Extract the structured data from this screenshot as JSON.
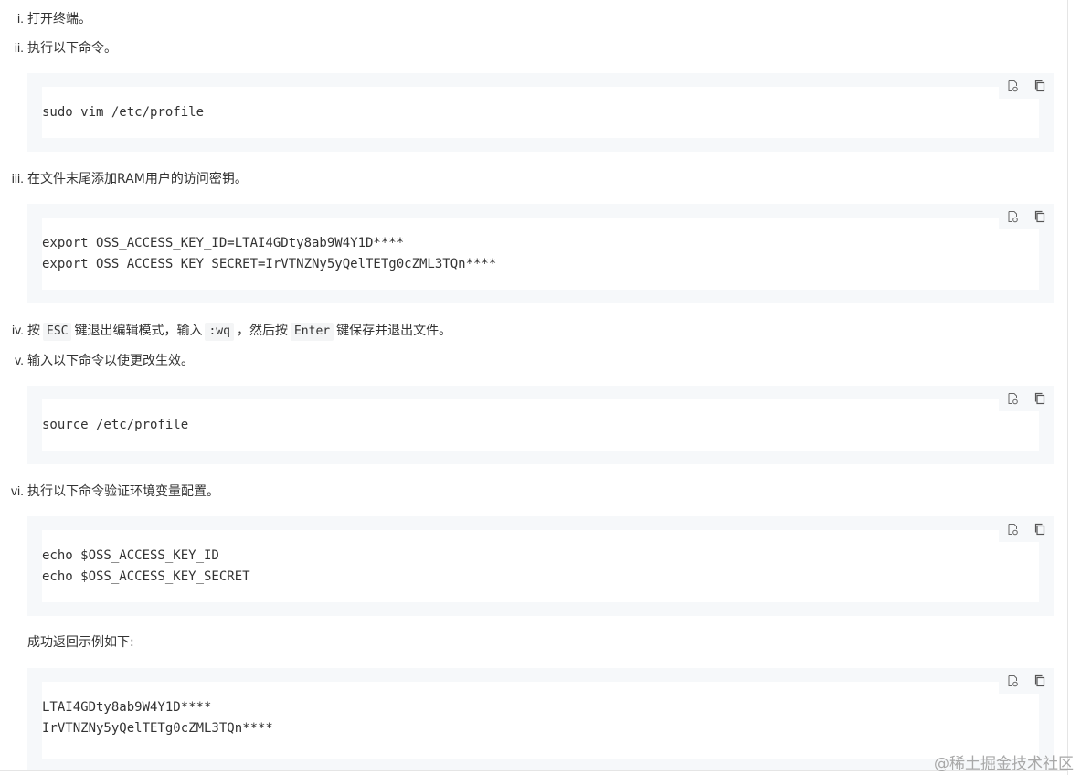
{
  "steps": [
    {
      "num": "i.",
      "text": "打开终端。"
    },
    {
      "num": "ii.",
      "text": "执行以下命令。"
    },
    {
      "num": "iii.",
      "text": "在文件末尾添加RAM用户的访问密钥。"
    },
    {
      "num": "iv.",
      "text_before": "按",
      "code1": "ESC",
      "text_mid1": "键退出编辑模式，输入",
      "code2": ":wq",
      "text_mid2": "，然后按",
      "code3": "Enter",
      "text_after": "键保存并退出文件。"
    },
    {
      "num": "v.",
      "text": "输入以下命令以使更改生效。"
    },
    {
      "num": "vi.",
      "text": "执行以下命令验证环境变量配置。"
    }
  ],
  "result_intro": "成功返回示例如下:",
  "code_blocks": [
    {
      "lines": [
        "sudo vim /etc/profile"
      ]
    },
    {
      "lines": [
        "export OSS_ACCESS_KEY_ID=LTAI4GDty8ab9W4Y1D****",
        "export OSS_ACCESS_KEY_SECRET=IrVTNZNy5yQelTETg0cZML3TQn****"
      ]
    },
    {
      "lines": [
        "source /etc/profile"
      ]
    },
    {
      "lines": [
        "echo $OSS_ACCESS_KEY_ID",
        "echo $OSS_ACCESS_KEY_SECRET"
      ]
    },
    {
      "lines": [
        "LTAI4GDty8ab9W4Y1D****",
        "IrVTNZNy5yQelTETg0cZML3TQn****"
      ]
    }
  ],
  "icons": {
    "toolbar": [
      "insert-code-icon",
      "copy-icon"
    ]
  },
  "watermark": "@稀土掘金技术社区"
}
